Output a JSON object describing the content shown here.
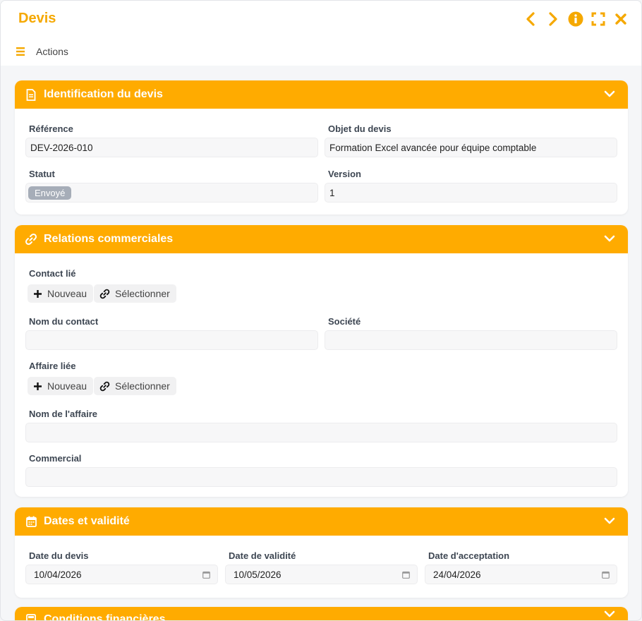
{
  "window": {
    "title": "Devis",
    "actions_label": "Actions"
  },
  "sections": {
    "identification": {
      "title": "Identification du devis",
      "reference_label": "Référence",
      "reference_value": "DEV-2026-010",
      "objet_label": "Objet du devis",
      "objet_value": "Formation Excel avancée pour équipe comptable",
      "statut_label": "Statut",
      "statut_value": "Envoyé",
      "version_label": "Version",
      "version_value": "1"
    },
    "relations": {
      "title": "Relations commerciales",
      "contact_lie_label": "Contact lié",
      "nouveau_label": "Nouveau",
      "selectionner_label": "Sélectionner",
      "nom_contact_label": "Nom du contact",
      "societe_label": "Société",
      "affaire_liee_label": "Affaire liée",
      "nom_affaire_label": "Nom de l'affaire",
      "commercial_label": "Commercial"
    },
    "dates": {
      "title": "Dates et validité",
      "date_devis_label": "Date du devis",
      "date_devis_value": "10/04/2026",
      "date_validite_label": "Date de validité",
      "date_validite_value": "10/05/2026",
      "date_acceptation_label": "Date d'acceptation",
      "date_acceptation_value": "24/04/2026"
    },
    "conditions": {
      "title": "Conditions financières"
    }
  },
  "colors": {
    "accent": "#ffab00",
    "title": "#f5a800",
    "badge": "#a6adb8"
  }
}
